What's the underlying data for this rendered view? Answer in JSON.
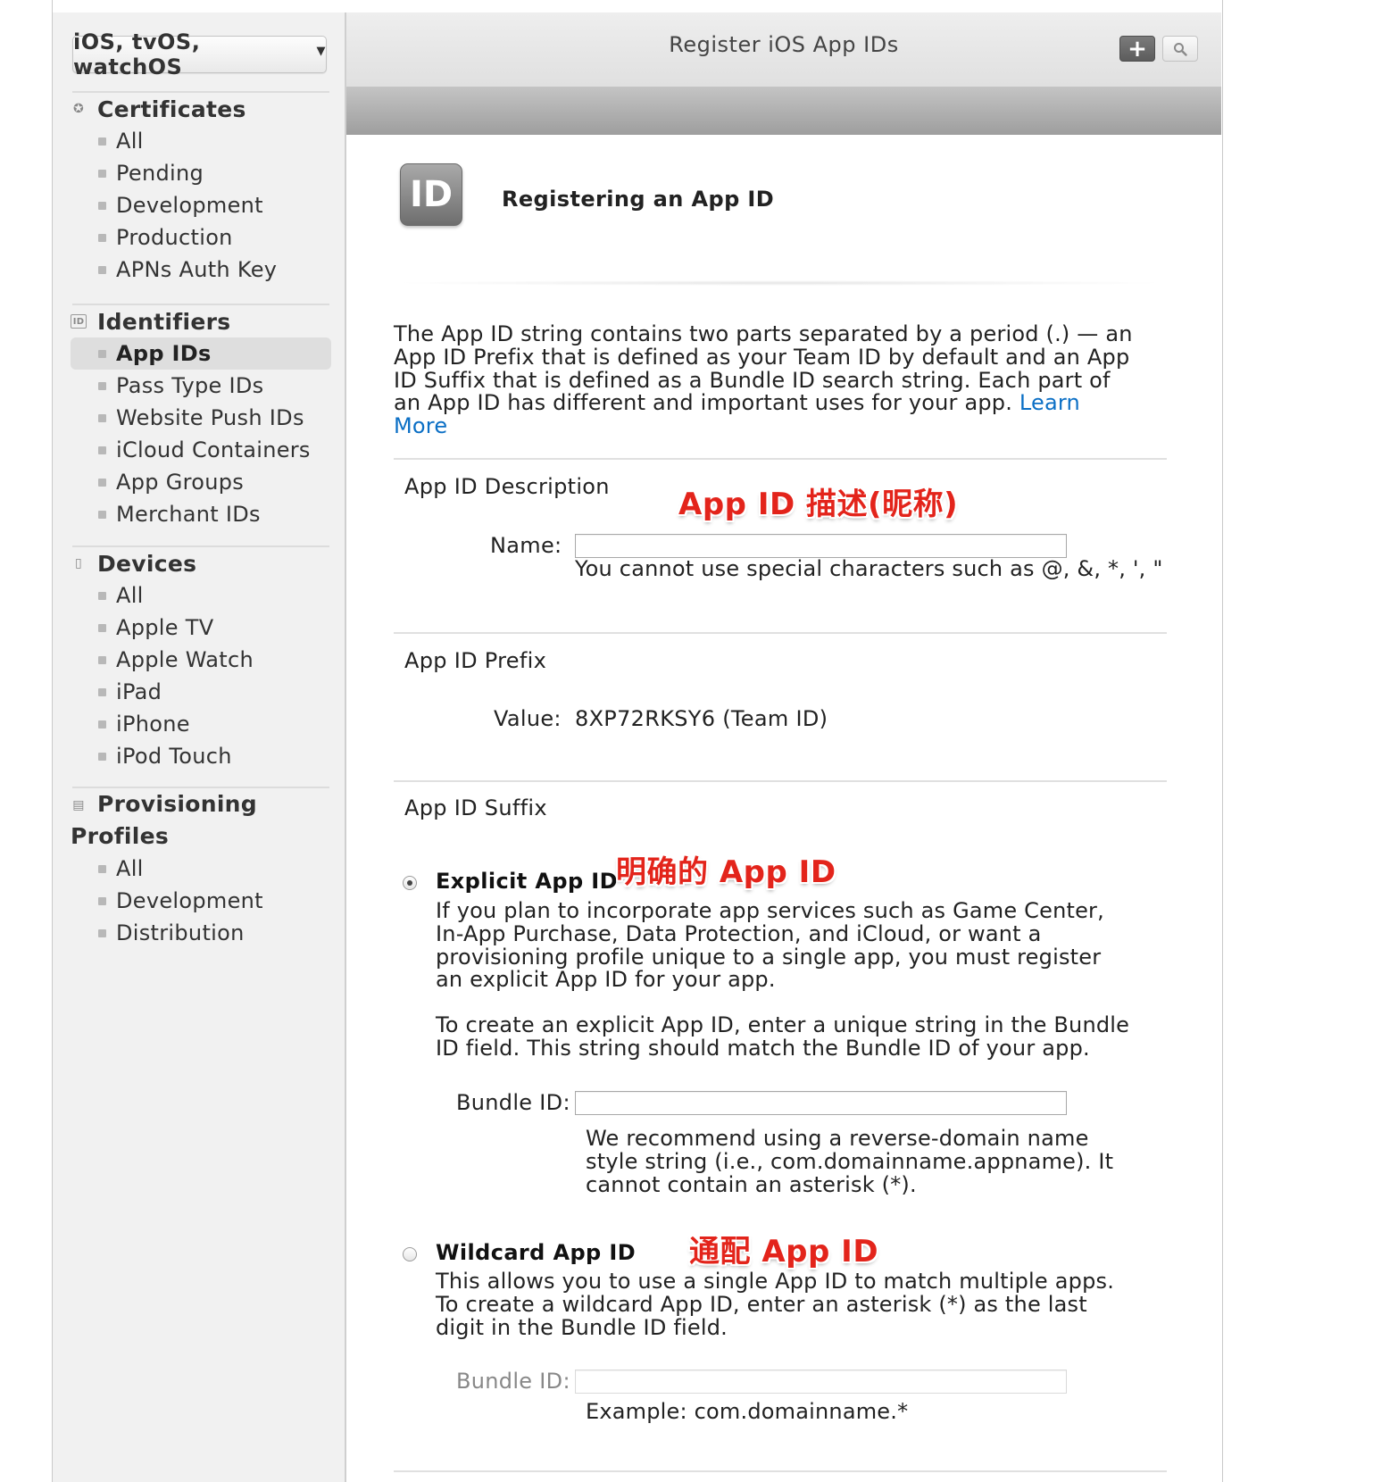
{
  "header": {
    "title": "Register iOS App IDs",
    "add_icon": "plus-icon",
    "search_icon": "search-icon"
  },
  "sidebar": {
    "platform_selector": "iOS, tvOS, watchOS",
    "sections": [
      {
        "title": "Certificates",
        "icon": "certificate-icon",
        "items": [
          "All",
          "Pending",
          "Development",
          "Production",
          "APNs Auth Key"
        ]
      },
      {
        "title": "Identifiers",
        "icon": "id-icon",
        "items": [
          "App IDs",
          "Pass Type IDs",
          "Website Push IDs",
          "iCloud Containers",
          "App Groups",
          "Merchant IDs"
        ],
        "active": "App IDs"
      },
      {
        "title": "Devices",
        "icon": "device-icon",
        "items": [
          "All",
          "Apple TV",
          "Apple Watch",
          "iPad",
          "iPhone",
          "iPod Touch"
        ]
      },
      {
        "title_line1": "Provisioning",
        "title_line2": "Profiles",
        "icon": "document-icon",
        "items": [
          "All",
          "Development",
          "Distribution"
        ]
      }
    ]
  },
  "main": {
    "icon_text": "ID",
    "title": "Registering an App ID",
    "intro_text": "The App ID string contains two parts separated by a period (.) — an App ID Prefix that is defined as your Team ID by default and an App ID Suffix that is defined as a Bundle ID search string. Each part of an App ID has different and important uses for your app.",
    "learn_more": "Learn More",
    "description": {
      "heading": "App ID Description",
      "name_label": "Name:",
      "name_value": "",
      "name_hint": "You cannot use special characters such as @, &, *, ', \""
    },
    "prefix": {
      "heading": "App ID Prefix",
      "value_label": "Value:",
      "value": "8XP72RKSY6 (Team ID)"
    },
    "suffix": {
      "heading": "App ID Suffix",
      "explicit": {
        "title": "Explicit App ID",
        "selected": true,
        "desc1": "If you plan to incorporate app services such as Game Center, In-App Purchase, Data Protection, and iCloud, or want a provisioning profile unique to a single app, you must register an explicit App ID for your app.",
        "desc2": "To create an explicit App ID, enter a unique string in the Bundle ID field. This string should match the Bundle ID of your app.",
        "bundle_label": "Bundle ID:",
        "bundle_value": "",
        "bundle_hint": "We recommend using a reverse-domain name style string (i.e., com.domainname.appname). It cannot contain an asterisk (*)."
      },
      "wildcard": {
        "title": "Wildcard App ID",
        "selected": false,
        "desc": "This allows you to use a single App ID to match multiple apps. To create a wildcard App ID, enter an asterisk (*) as the last digit in the Bundle ID field.",
        "bundle_label": "Bundle ID:",
        "bundle_value": "",
        "bundle_hint": "Example: com.domainname.*"
      }
    }
  },
  "annotations": {
    "description": "App ID 描述(昵称)",
    "explicit": "明确的 App ID",
    "wildcard": "通配 App ID"
  },
  "colors": {
    "link": "#0b6fc5",
    "annotation": "#e3241b"
  }
}
